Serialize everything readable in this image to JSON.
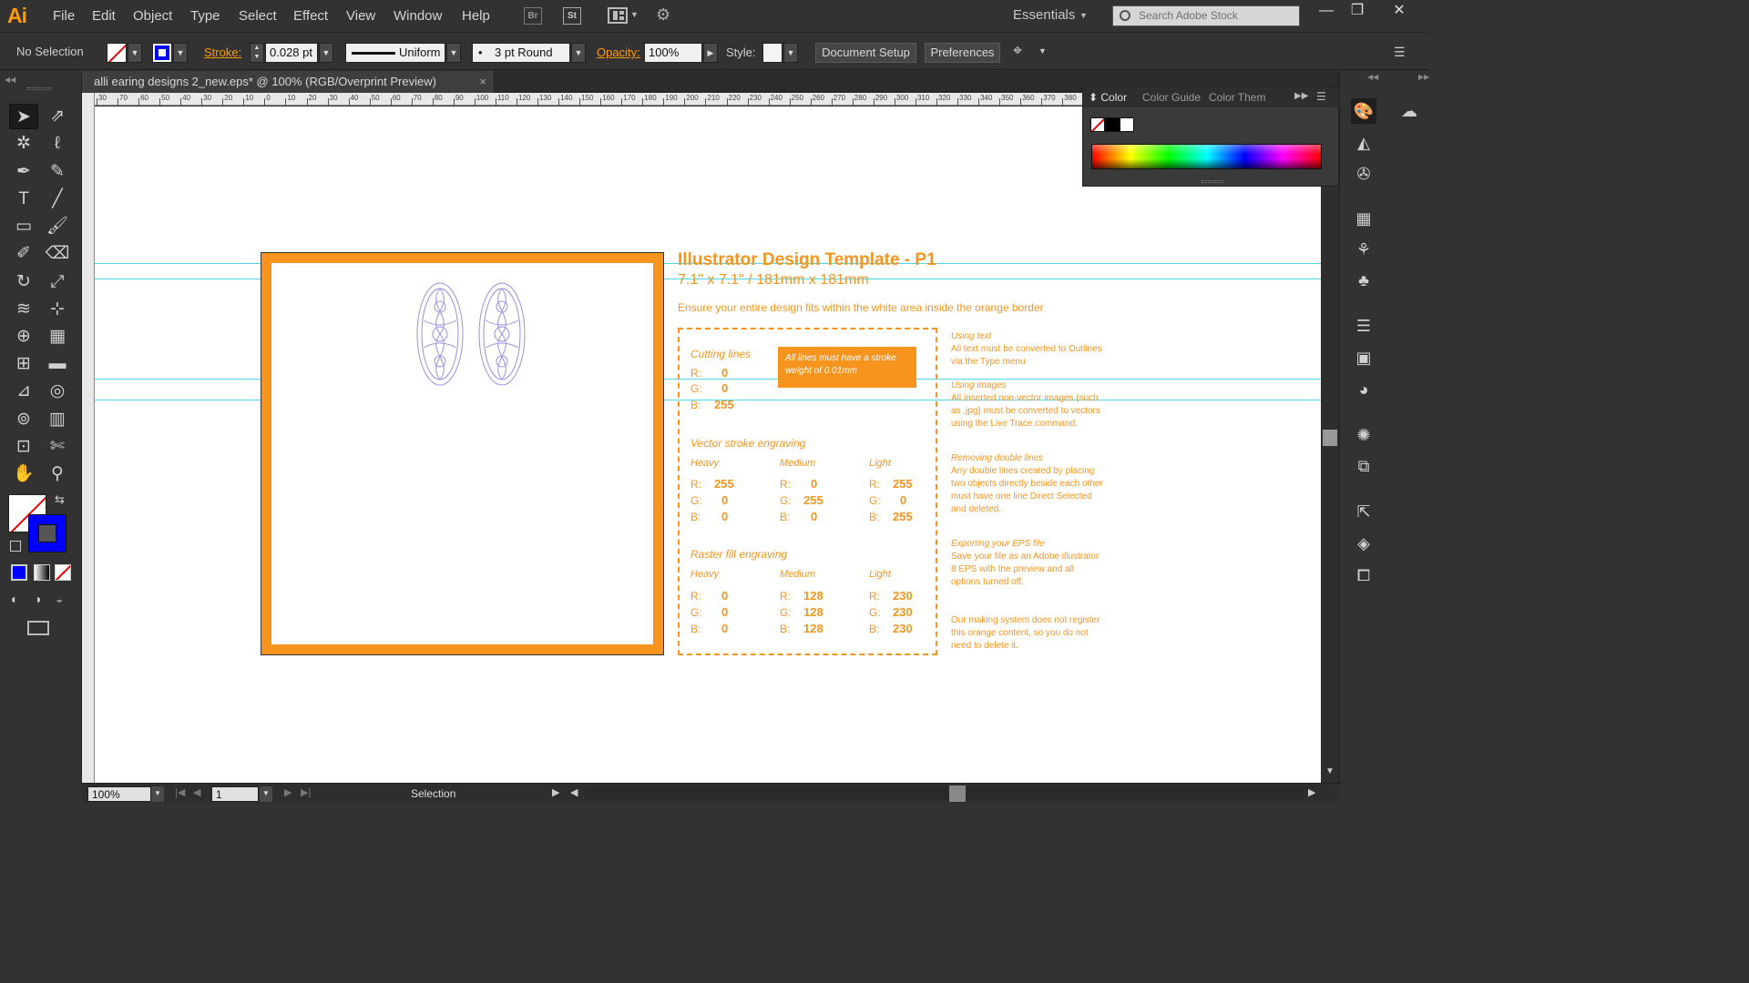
{
  "app": {
    "logo": "Ai",
    "menu": [
      "File",
      "Edit",
      "Object",
      "Type",
      "Select",
      "Effect",
      "View",
      "Window",
      "Help"
    ],
    "bridge_label": "Br",
    "stock_label": "St",
    "workspace": "Essentials",
    "search_placeholder": "Search Adobe Stock",
    "window_buttons": [
      "—",
      "❐",
      "✕"
    ]
  },
  "control": {
    "selection": "No Selection",
    "stroke_label": "Stroke:",
    "stroke_value": "0.028 pt",
    "profile": "Uniform",
    "brush": "3 pt Round",
    "opacity_label": "Opacity:",
    "opacity_value": "100%",
    "style_label": "Style:",
    "document_setup": "Document Setup",
    "preferences": "Preferences"
  },
  "document": {
    "tab_title": "alli earing designs 2_new.eps* @ 100% (RGB/Overprint Preview)",
    "close": "×"
  },
  "ruler_ticks": [
    "30",
    "70",
    "60",
    "50",
    "40",
    "30",
    "20",
    "10",
    "0",
    "10",
    "20",
    "30",
    "40",
    "50",
    "60",
    "70",
    "80",
    "90",
    "100",
    "110",
    "120",
    "130",
    "140",
    "150",
    "160",
    "170",
    "180",
    "190",
    "200",
    "210",
    "220",
    "230",
    "240",
    "250",
    "260",
    "270",
    "280",
    "290",
    "300",
    "310",
    "320",
    "330",
    "340",
    "350",
    "360",
    "370",
    "380"
  ],
  "template": {
    "title": "Illustrator Design Template - P1",
    "subtitle": "7.1\" x 7.1\" / 181mm x 181mm",
    "note": "Ensure your entire design fits within the white area inside the orange border",
    "callout": "All  lines must have a stroke weight of 0.01mm",
    "cutting": {
      "heading": "Cutting lines",
      "r": "0",
      "g": "0",
      "b": "255"
    },
    "vector": {
      "heading": "Vector stroke engraving",
      "heavy": {
        "label": "Heavy",
        "r": "255",
        "g": "0",
        "b": "0"
      },
      "medium": {
        "label": "Medium",
        "r": "0",
        "g": "255",
        "b": "0"
      },
      "light": {
        "label": "Light",
        "r": "255",
        "g": "0",
        "b": "255"
      }
    },
    "raster": {
      "heading": "Raster fill engraving",
      "heavy": {
        "label": "Heavy",
        "r": "0",
        "g": "0",
        "b": "0"
      },
      "medium": {
        "label": "Medium",
        "r": "128",
        "g": "128",
        "b": "128"
      },
      "light": {
        "label": "Light",
        "r": "230",
        "g": "230",
        "b": "230"
      }
    },
    "channel_labels": {
      "r": "R:",
      "g": "G:",
      "b": "B:"
    },
    "side": [
      {
        "heading": "Using text",
        "body": "All text must be converted to Outlines via the Type menu"
      },
      {
        "heading": "Using images",
        "body": "All inserted non-vector images (such as .jpg) must be converted to vectors using the Live Trace command."
      },
      {
        "heading": "Removing double lines",
        "body": "Any double lines created by placing two objects directly beside each other must have one line Direct Selected and deleted."
      },
      {
        "heading": "Exporting your EPS file",
        "body": "Save your file as an Adobe illustrator 8 EPS with the preview and all options turned off."
      },
      {
        "heading": "",
        "body": "Our making system does not register this orange content, so you do not need to delete it."
      }
    ]
  },
  "color_panel": {
    "tabs": [
      "Color",
      "Color Guide",
      "Color Them"
    ]
  },
  "status": {
    "zoom": "100%",
    "artboard": "1",
    "tool": "Selection"
  },
  "colors": {
    "accent": "#f7941d",
    "guide": "#4fd8e8",
    "fill_blue": "#0000ff"
  }
}
